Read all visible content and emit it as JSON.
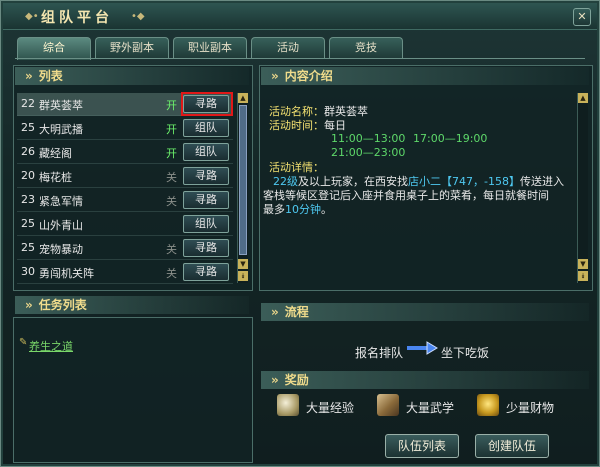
{
  "window": {
    "title": "组队平台",
    "close_label": "✕"
  },
  "tabs": [
    "综合",
    "野外副本",
    "职业副本",
    "活动",
    "竞技"
  ],
  "list_section": {
    "title": "列表"
  },
  "activities": [
    {
      "level": "22",
      "name": "群英荟萃",
      "status": "开",
      "status_open": true,
      "action": "寻路"
    },
    {
      "level": "25",
      "name": "大明武播",
      "status": "开",
      "status_open": true,
      "action": "组队"
    },
    {
      "level": "26",
      "name": "藏经阁",
      "status": "开",
      "status_open": true,
      "action": "组队"
    },
    {
      "level": "20",
      "name": "梅花桩",
      "status": "关",
      "status_open": false,
      "action": "寻路"
    },
    {
      "level": "23",
      "name": "紧急军情",
      "status": "关",
      "status_open": false,
      "action": "寻路"
    },
    {
      "level": "25",
      "name": "山外青山",
      "status": "",
      "status_open": false,
      "action": "组队"
    },
    {
      "level": "25",
      "name": "宠物暴动",
      "status": "关",
      "status_open": false,
      "action": "寻路"
    },
    {
      "level": "30",
      "name": "勇闯机关阵",
      "status": "关",
      "status_open": false,
      "action": "寻路"
    }
  ],
  "task_section": {
    "title": "任务列表",
    "items": [
      "养生之道"
    ]
  },
  "content_section": {
    "title": "内容介绍",
    "name_label": "活动名称：",
    "name_value": "群英荟萃",
    "time_label": "活动时间：",
    "time_value": "每日",
    "time_slots": [
      "11:00—13:00",
      "17:00—19:00",
      "21:00—23:00"
    ],
    "detail_label": "活动详情：",
    "detail_lines": [
      [
        "22级",
        "及以上玩家，在西安找",
        "店小二【747，-158】",
        "传送进入"
      ],
      [
        "客栈等候区登记后入座并食用桌子上的菜肴，每日就餐时间"
      ],
      [
        "最多",
        "10分钟",
        "。"
      ]
    ]
  },
  "flow_section": {
    "title": "流程",
    "step1": "报名排队",
    "step2": "坐下吃饭"
  },
  "reward_section": {
    "title": "奖励",
    "items": [
      {
        "icon": "exp-orb-icon",
        "label": "大量经验"
      },
      {
        "icon": "martial-scroll-icon",
        "label": "大量武学"
      },
      {
        "icon": "coins-icon",
        "label": "少量财物"
      }
    ]
  },
  "buttons": {
    "team_list": "队伍列表",
    "create_team": "创建队伍"
  },
  "colors": {
    "accent_gold": "#f0dc8c",
    "open_green": "#6cf26c",
    "highlight_red": "#e01818",
    "link_cyan": "#4ec8f0"
  }
}
